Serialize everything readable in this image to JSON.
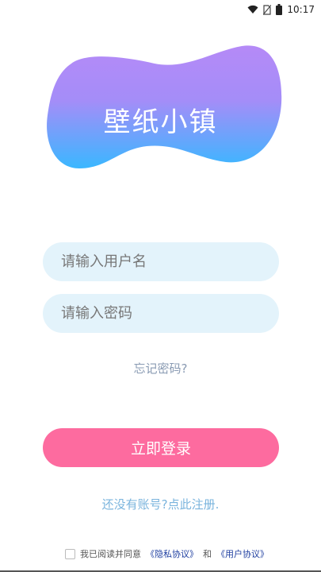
{
  "status_bar": {
    "time": "10:17",
    "icons": [
      "wifi-icon",
      "no-sim-icon",
      "battery-icon"
    ]
  },
  "logo": {
    "title": "壁纸小镇",
    "gradient_top": "#b58af7",
    "gradient_bottom": "#3ab7ff"
  },
  "login_form": {
    "username_placeholder": "请输入用户名",
    "username_value": "",
    "password_placeholder": "请输入密码",
    "password_value": "",
    "forgot_label": "忘记密码?",
    "login_label": "立即登录",
    "register_label": "还没有账号?点此注册."
  },
  "agreement": {
    "prefix": "我已阅读并同意",
    "privacy_link": "《隐私协议》",
    "conjunction": "和",
    "user_link": "《用户协议》",
    "checked": false
  },
  "colors": {
    "field_bg": "#e3f3fb",
    "login_button": "#fd6b9f",
    "register_text": "#7ab4dd",
    "forgot_text": "#8a9bb3",
    "link_text": "#1f3fa0"
  }
}
